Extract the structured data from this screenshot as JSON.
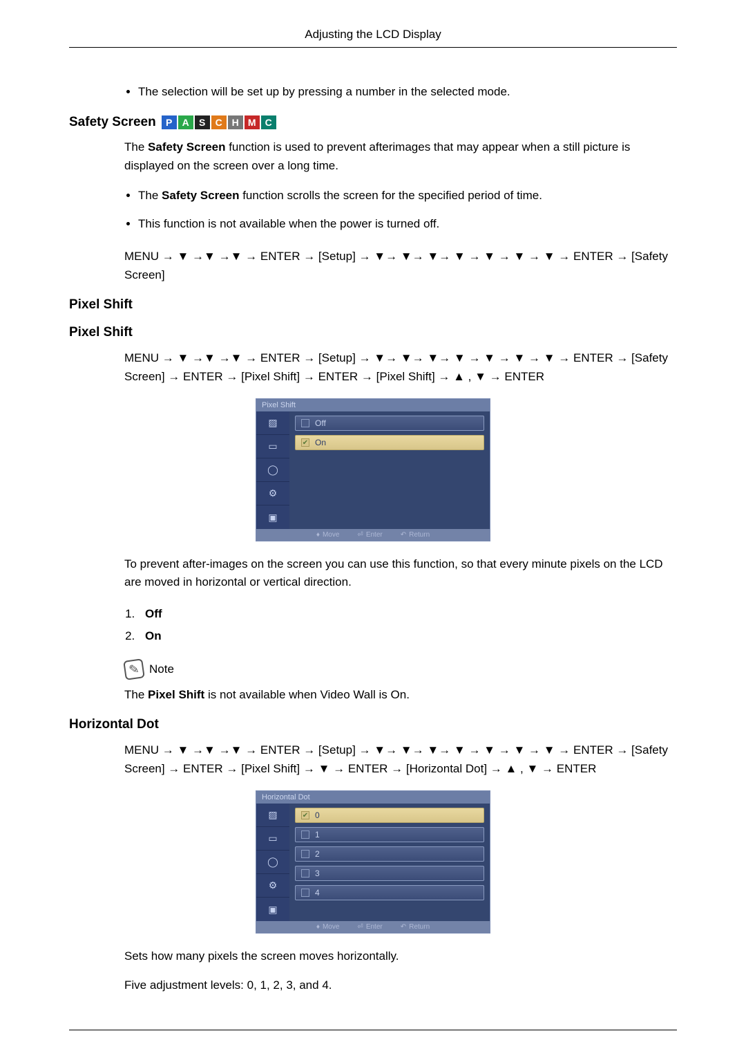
{
  "header": {
    "title": "Adjusting the LCD Display"
  },
  "intro_bullets": [
    "The selection will be set up by pressing a number in the selected mode."
  ],
  "safety_screen": {
    "title": "Safety Screen",
    "badges": [
      "P",
      "A",
      "S",
      "C",
      "H",
      "M",
      "C"
    ],
    "desc_prefix": "The ",
    "desc_bold": "Safety Screen",
    "desc_suffix": " function is used to prevent afterimages that may appear when a still picture is displayed on the screen over a long time.",
    "bullets": [
      {
        "pre": "The ",
        "bold": "Safety Screen",
        "post": " function scrolls the screen for the specified period of time."
      },
      {
        "pre": "",
        "bold": "",
        "post": "This function is not available when the power is turned off."
      }
    ],
    "path": "MENU → ▼ →▼ →▼ → ENTER → [Setup] → ▼→ ▼→ ▼→ ▼ → ▼ → ▼ → ▼ → ENTER → [Safety Screen]"
  },
  "pixel_shift": {
    "title1": "Pixel Shift",
    "title2": "Pixel Shift",
    "path": "MENU → ▼ →▼ →▼ → ENTER → [Setup] → ▼→ ▼→ ▼→ ▼ → ▼ → ▼ → ▼ → ENTER → [Safety Screen] → ENTER → [Pixel Shift] → ENTER → [Pixel Shift] → ▲ , ▼ → ENTER",
    "osd": {
      "title": "Pixel Shift",
      "options": [
        {
          "label": "Off",
          "selected": false
        },
        {
          "label": "On",
          "selected": true
        }
      ],
      "footer": {
        "move": "Move",
        "enter": "Enter",
        "ret": "Return"
      }
    },
    "desc": "To prevent after-images on the screen you can use this function, so that every minute pixels on the LCD are moved in horizontal or vertical direction.",
    "list": [
      "Off",
      "On"
    ],
    "note_label": "Note",
    "note_text_pre": "The ",
    "note_text_bold": "Pixel Shift",
    "note_text_post": " is not available when Video Wall is On."
  },
  "horizontal_dot": {
    "title": "Horizontal Dot",
    "path": "MENU → ▼ →▼ →▼ → ENTER → [Setup] → ▼→ ▼→ ▼→ ▼ → ▼ → ▼ → ▼ → ENTER → [Safety Screen] → ENTER → [Pixel Shift] → ▼ → ENTER → [Horizontal Dot] → ▲ , ▼ → ENTER",
    "osd": {
      "title": "Horizontal Dot",
      "options": [
        {
          "label": "0",
          "selected": true
        },
        {
          "label": "1",
          "selected": false
        },
        {
          "label": "2",
          "selected": false
        },
        {
          "label": "3",
          "selected": false
        },
        {
          "label": "4",
          "selected": false
        }
      ],
      "footer": {
        "move": "Move",
        "enter": "Enter",
        "ret": "Return"
      }
    },
    "desc1": "Sets how many pixels the screen moves horizontally.",
    "desc2": "Five adjustment levels: 0, 1, 2, 3, and 4."
  }
}
